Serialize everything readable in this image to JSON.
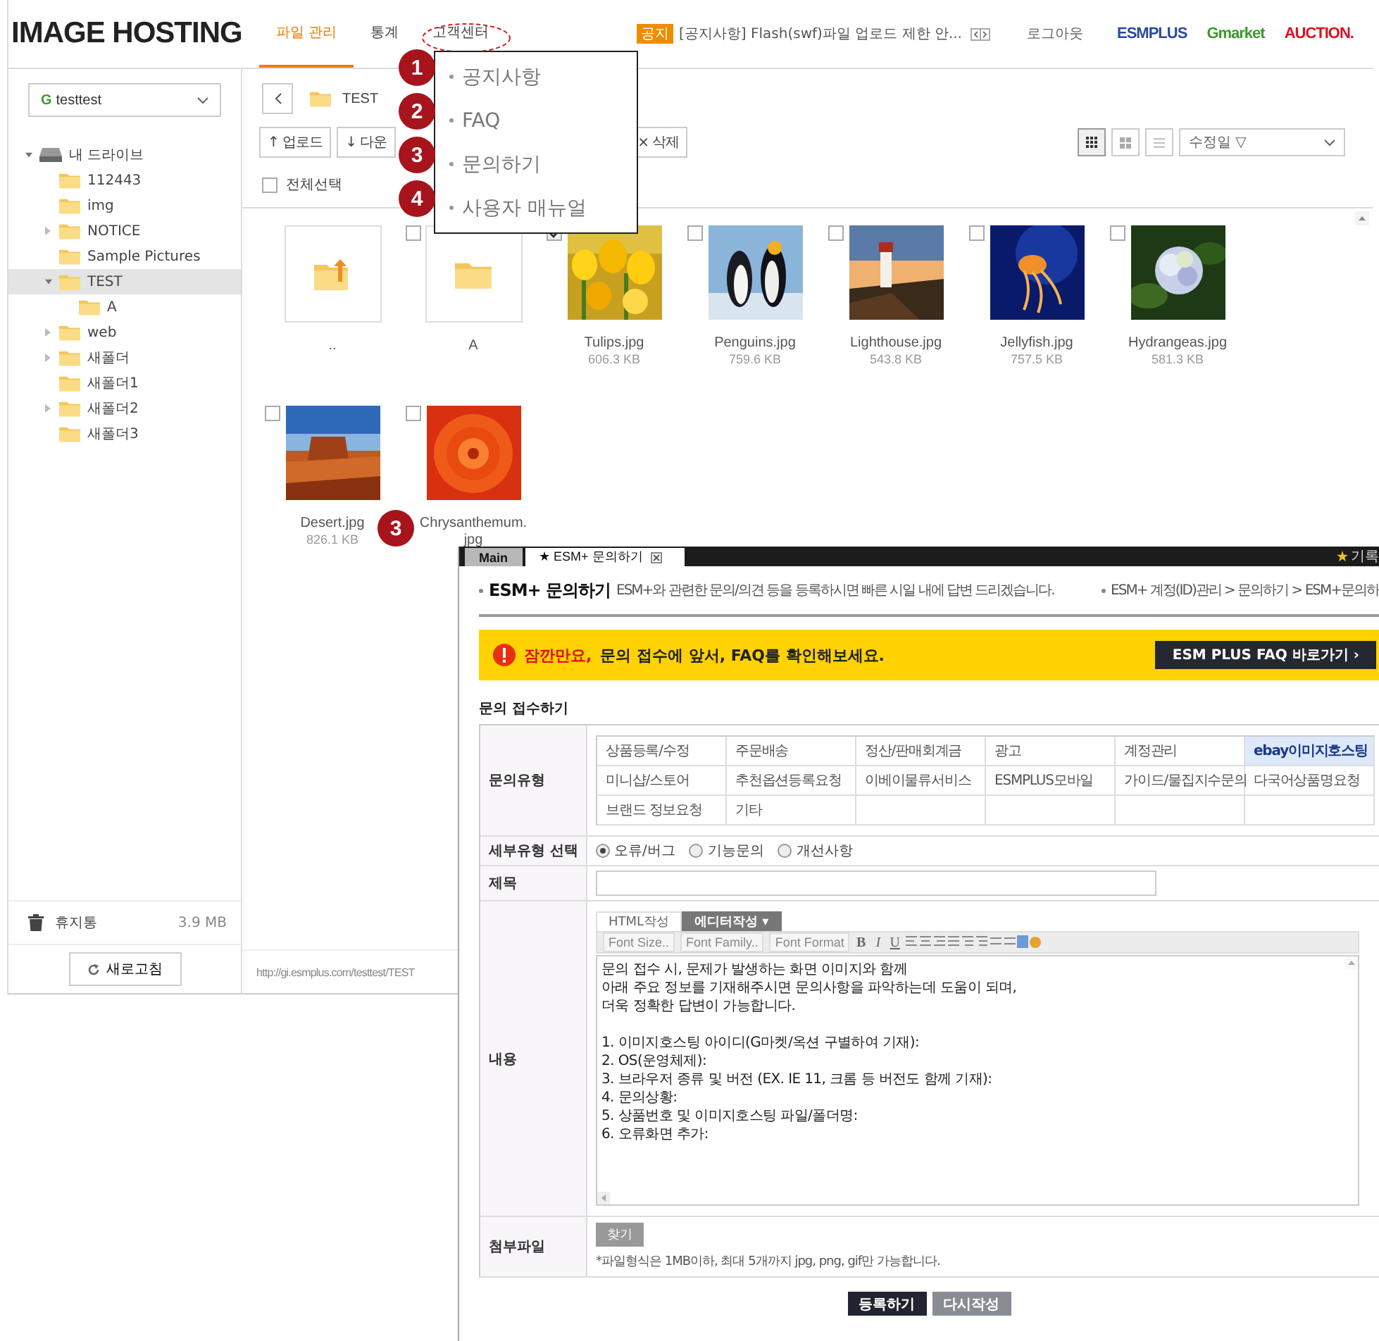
{
  "app": {
    "logo": "IMAGE HOSTING",
    "nav": [
      {
        "label": "파일 관리",
        "selected": true
      },
      {
        "label": "통계",
        "selected": false
      },
      {
        "label": "고객센터",
        "selected": false
      }
    ],
    "notice": {
      "badge": "공지",
      "text": "[공지사항] Flash(swf)파일 업로드 제한 안..."
    },
    "logout": "로그아웃",
    "partners": [
      "ESMPLUS",
      "Gmarket",
      "AUCTION."
    ]
  },
  "sidebar": {
    "account": {
      "badge": "G",
      "name": "testtest"
    },
    "tree": [
      {
        "label": "내 드라이브",
        "kind": "drive",
        "selected": false,
        "expanded": true,
        "children": [
          {
            "label": "112443",
            "selected": false
          },
          {
            "label": "img",
            "selected": false
          },
          {
            "label": "NOTICE",
            "selected": false,
            "expanded": false
          },
          {
            "label": "Sample Pictures",
            "selected": false
          },
          {
            "label": "TEST",
            "selected": true,
            "expanded": true,
            "children": [
              {
                "label": "A",
                "selected": false
              }
            ]
          },
          {
            "label": "web",
            "selected": false,
            "expanded": false
          },
          {
            "label": "새폴더",
            "selected": false,
            "expanded": false
          },
          {
            "label": "새폴더1",
            "selected": false
          },
          {
            "label": "새폴더2",
            "selected": false,
            "expanded": false
          },
          {
            "label": "새폴더3",
            "selected": false
          }
        ]
      }
    ],
    "trash": {
      "label": "휴지통",
      "size": "3.9 MB"
    },
    "refresh": "새로고침"
  },
  "content": {
    "path": "TEST",
    "toolbar": [
      "↑ 업로드",
      "↓ 다운",
      "× 삭제"
    ],
    "views": [
      {
        "kind": "large-grid",
        "selected": true
      },
      {
        "kind": "small-grid",
        "selected": false
      },
      {
        "kind": "list",
        "selected": false
      }
    ],
    "sort": "수정일 ▽",
    "select_all": {
      "label": "전체선택",
      "checked": false
    },
    "files": [
      {
        "kind": "up",
        "name": ".."
      },
      {
        "kind": "folder",
        "name": "A",
        "checked": false
      },
      {
        "kind": "picture",
        "name": "Tulips.jpg",
        "size": "606.3 KB",
        "checked": true
      },
      {
        "kind": "picture",
        "name": "Penguins.jpg",
        "size": "759.6 KB",
        "checked": false
      },
      {
        "kind": "picture",
        "name": "Lighthouse.jpg",
        "size": "543.8 KB",
        "checked": false
      },
      {
        "kind": "picture",
        "name": "Jellyfish.jpg",
        "size": "757.5 KB",
        "checked": false
      },
      {
        "kind": "picture",
        "name": "Hydrangeas.jpg",
        "size": "581.3 KB",
        "checked": false
      },
      {
        "kind": "picture",
        "name": "Desert.jpg",
        "size": "826.1 KB",
        "checked": false
      },
      {
        "kind": "picture",
        "name": "Chrysanthemum.jpg",
        "checked": false
      }
    ],
    "url": "http://gi.esmplus.com/testtest/TEST"
  },
  "support_menu": {
    "items": [
      "공지사항",
      "FAQ",
      "문의하기",
      "사용자 매뉴얼"
    ],
    "markers": [
      "1",
      "2",
      "3",
      "4"
    ],
    "file_marker": "3"
  },
  "inquiry_window": {
    "tabs": [
      {
        "label": "Main",
        "selected": false
      },
      {
        "label": "★ ESM+ 문의하기",
        "selected": true
      }
    ],
    "corner": "기록",
    "title": "ESM+ 문의하기",
    "description": "ESM+와 관련한 문의/의견 등을 등록하시면 빠른 시일 내에 답변 드리겠습니다.",
    "breadcrumb": "ESM+ 계정(ID)관리 > 문의하기 > ESM+문의하",
    "banner": {
      "alert": "잠깐만요,",
      "message": "문의 접수에 앞서, FAQ를 확인해보세요.",
      "button": "ESM PLUS FAQ 바로가기 ›"
    },
    "section": "문의 접수하기",
    "type_label": "문의유형",
    "types": [
      {
        "label": "상품등록/수정",
        "selected": false
      },
      {
        "label": "주문배송",
        "selected": false
      },
      {
        "label": "정산/판매회계금",
        "selected": false
      },
      {
        "label": "광고",
        "selected": false
      },
      {
        "label": "계정관리",
        "selected": false
      },
      {
        "label": "ebay이미지호스팅",
        "selected": true
      },
      {
        "label": "미니샵/스토어",
        "selected": false
      },
      {
        "label": "추천옵션등록요청",
        "selected": false
      },
      {
        "label": "이베이물류서비스",
        "selected": false
      },
      {
        "label": "ESMPLUS모바일",
        "selected": false
      },
      {
        "label": "가이드/물집지수문의",
        "selected": false
      },
      {
        "label": "다국어상품명요청",
        "selected": false
      },
      {
        "label": "브랜드 정보요청",
        "selected": false
      },
      {
        "label": "기타",
        "selected": false
      }
    ],
    "subtype_label": "세부유형 선택",
    "subtypes": [
      {
        "label": "오류/버그",
        "selected": true
      },
      {
        "label": "기능문의",
        "selected": false
      },
      {
        "label": "개선사항",
        "selected": false
      }
    ],
    "subject_label": "제목",
    "body_label": "내용",
    "editor_tabs": [
      {
        "label": "HTML작성",
        "selected": false
      },
      {
        "label": "에디터작성 ▾",
        "selected": true
      }
    ],
    "editor_selects": [
      "Font Size..",
      "Font Family..",
      "Font Format"
    ],
    "editor_buttons": [
      "B",
      "I",
      "U"
    ],
    "editor_text": "문의 접수 시, 문제가 발생하는 화면 이미지와 함께\n아래 주요 정보를 기재해주시면 문의사항을 파악하는데 도움이 되며,\n더욱 정확한 답변이 가능합니다.\n\n1. 이미지호스팅 아이디(G마켓/옥션 구별하여 기재):\n2. OS(운영체제):\n3. 브라우저 종류 및 버전 (EX. IE 11, 크롬 등 버전도 함께 기재):\n4. 문의상황:\n5. 상품번호 및 이미지호스팅 파일/폴더명:\n6. 오류화면 추가:",
    "attach_label": "첨부파일",
    "attach_button": "찾기",
    "attach_note": "*파일형식은 1MB이하, 최대 5개까지 jpg, png, gif만 가능합니다.",
    "actions": [
      "등록하기",
      "다시작성"
    ]
  }
}
